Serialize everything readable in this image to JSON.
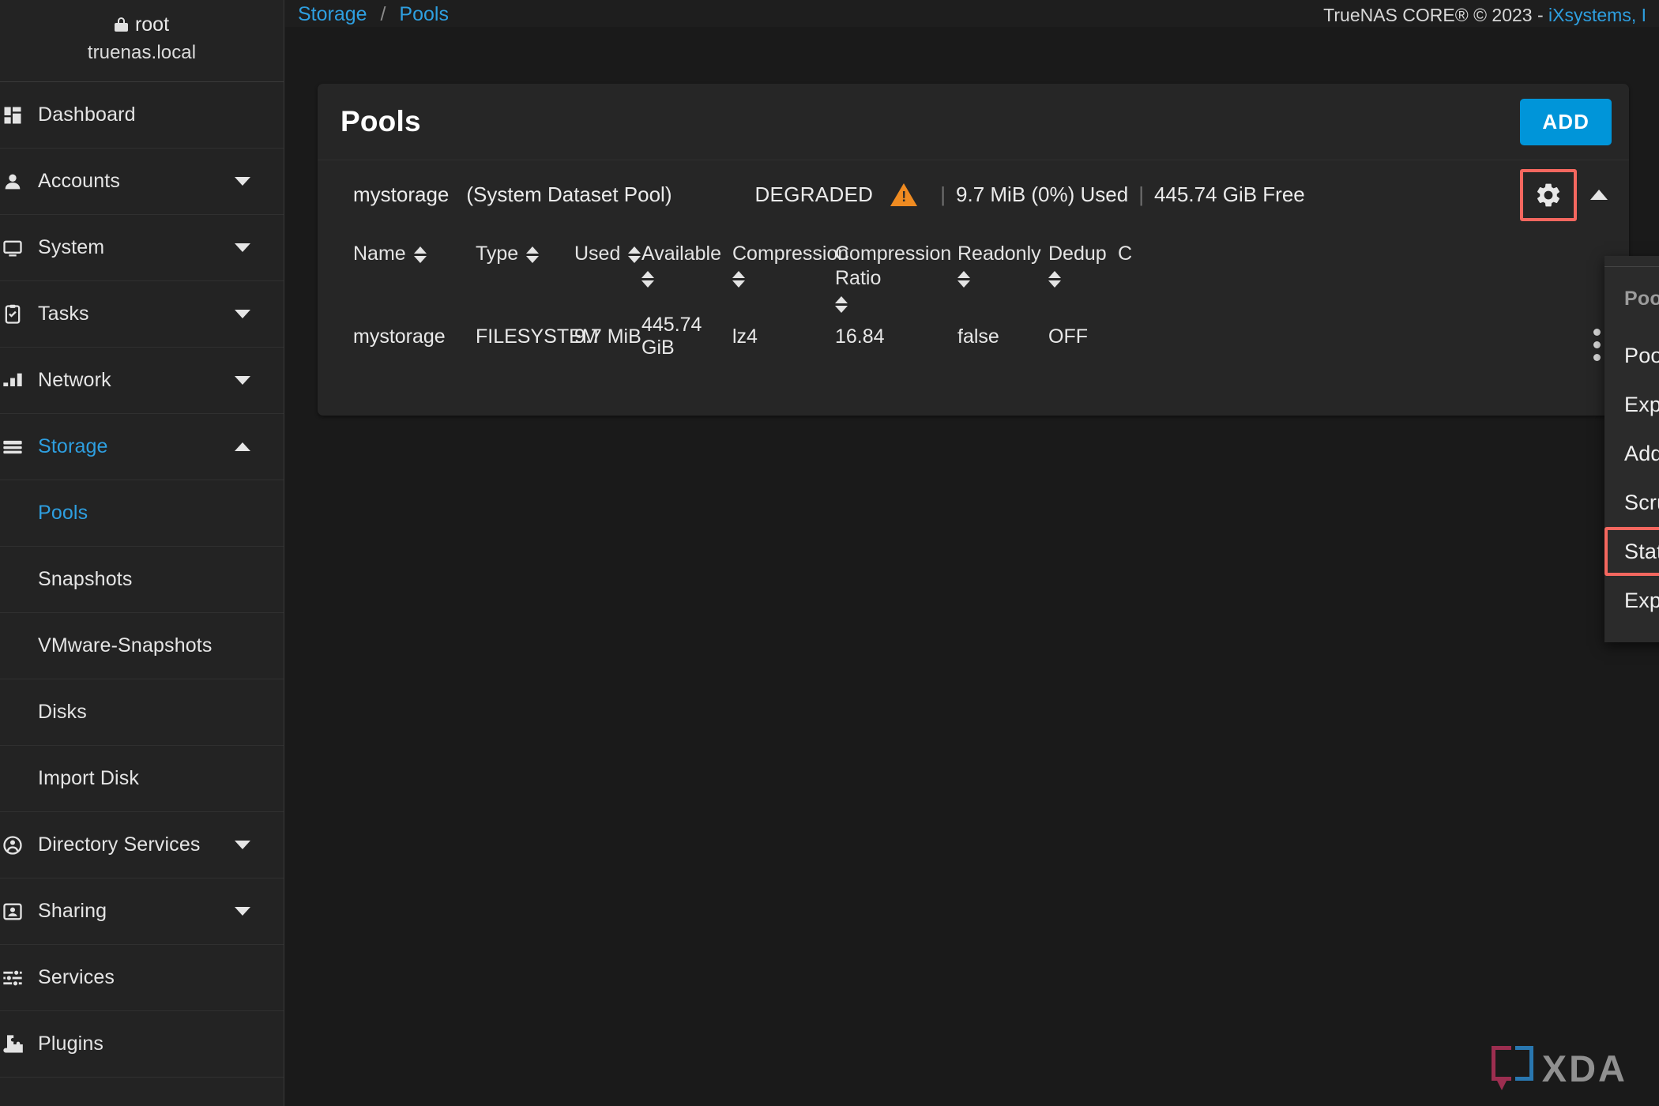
{
  "sidebar": {
    "user": {
      "name": "root",
      "host": "truenas.local",
      "lock_icon": "lock-icon"
    },
    "items": [
      {
        "label": "Dashboard",
        "icon": "dashboard-icon",
        "expandable": false,
        "active": false,
        "sub": false
      },
      {
        "label": "Accounts",
        "icon": "account-icon",
        "expandable": true,
        "expanded": false,
        "active": false,
        "sub": false
      },
      {
        "label": "System",
        "icon": "system-icon",
        "expandable": true,
        "expanded": false,
        "active": false,
        "sub": false
      },
      {
        "label": "Tasks",
        "icon": "tasks-icon",
        "expandable": true,
        "expanded": false,
        "active": false,
        "sub": false
      },
      {
        "label": "Network",
        "icon": "network-icon",
        "expandable": true,
        "expanded": false,
        "active": false,
        "sub": false
      },
      {
        "label": "Storage",
        "icon": "storage-icon",
        "expandable": true,
        "expanded": true,
        "active": true,
        "sub": false
      },
      {
        "label": "Pools",
        "icon": "",
        "expandable": false,
        "active": true,
        "sub": true
      },
      {
        "label": "Snapshots",
        "icon": "",
        "expandable": false,
        "active": false,
        "sub": true
      },
      {
        "label": "VMware-Snapshots",
        "icon": "",
        "expandable": false,
        "active": false,
        "sub": true
      },
      {
        "label": "Disks",
        "icon": "",
        "expandable": false,
        "active": false,
        "sub": true
      },
      {
        "label": "Import Disk",
        "icon": "",
        "expandable": false,
        "active": false,
        "sub": true
      },
      {
        "label": "Directory Services",
        "icon": "directory-services-icon",
        "expandable": true,
        "expanded": false,
        "active": false,
        "sub": false
      },
      {
        "label": "Sharing",
        "icon": "sharing-icon",
        "expandable": true,
        "expanded": false,
        "active": false,
        "sub": false
      },
      {
        "label": "Services",
        "icon": "services-icon",
        "expandable": false,
        "active": false,
        "sub": false
      },
      {
        "label": "Plugins",
        "icon": "plugins-icon",
        "expandable": false,
        "active": false,
        "sub": false
      }
    ]
  },
  "topbar": {
    "breadcrumb": {
      "parent": "Storage",
      "separator": "/",
      "current": "Pools"
    },
    "copyright": {
      "text": "TrueNAS CORE® © 2023 - ",
      "link": "iXsystems, I"
    }
  },
  "card": {
    "title": "Pools",
    "add_label": "ADD"
  },
  "pool": {
    "name": "mystorage",
    "system_dataset_label": "(System Dataset Pool)",
    "state": "DEGRADED",
    "warn_icon": "warning-triangle-icon",
    "used": "9.7 MiB (0%) Used",
    "free": "445.74 GiB Free",
    "separator": "|",
    "gear_icon": "gear-icon",
    "collapse_icon": "chevron-up-icon"
  },
  "table": {
    "headers": [
      {
        "label": "Name",
        "sortable": true,
        "class": "c-name"
      },
      {
        "label": "Type",
        "sortable": true,
        "class": "c-type"
      },
      {
        "label": "Used",
        "sortable": true,
        "class": "c-used"
      },
      {
        "label": "Available",
        "sortable": true,
        "class": "c-avail"
      },
      {
        "label": "Compression",
        "sortable": true,
        "class": "c-comp"
      },
      {
        "label": "Compression Ratio",
        "sortable": true,
        "class": "c-ratio"
      },
      {
        "label": "Readonly",
        "sortable": true,
        "class": "c-ro"
      },
      {
        "label": "Dedup",
        "sortable": true,
        "class": "c-dedup"
      },
      {
        "label": "C",
        "sortable": false,
        "class": "c-cmt"
      }
    ],
    "rows": [
      {
        "name": "mystorage",
        "type": "FILESYSTEM",
        "used": "9.7 MiB",
        "available": "445.74 GiB",
        "compression": "lz4",
        "compression_ratio": "16.84",
        "readonly": "false",
        "dedup": "OFF",
        "comments": ""
      }
    ],
    "row_menu_icon": "kebab-menu-icon"
  },
  "pool_actions_menu": {
    "header": "Pool Actions",
    "items": [
      {
        "label": "Pool Options",
        "highlighted": false
      },
      {
        "label": "Export/Disconnect",
        "highlighted": false
      },
      {
        "label": "Add Vdevs",
        "highlighted": false
      },
      {
        "label": "Scrub Pool",
        "highlighted": false
      },
      {
        "label": "Status",
        "highlighted": true
      },
      {
        "label": "Expand Pool",
        "highlighted": false
      }
    ]
  },
  "watermark": {
    "text": "XDA"
  },
  "colors": {
    "accent_blue": "#2e9fe0",
    "button_blue": "#0095d9",
    "warning_orange": "#ef8b21",
    "highlight_red": "#f4675f",
    "page_bg": "#1a1a1a",
    "card_bg": "#262626",
    "sidebar_bg": "#232323"
  }
}
